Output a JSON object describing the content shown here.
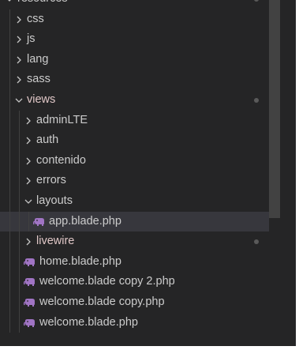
{
  "explorer": {
    "tree": [
      {
        "label": "resources",
        "twistie": "chevron-down-icon",
        "has_dot": true
      },
      {
        "label": "css",
        "twistie": "chevron-right-icon",
        "has_dot": false
      },
      {
        "label": "js",
        "twistie": "chevron-right-icon",
        "has_dot": false
      },
      {
        "label": "lang",
        "twistie": "chevron-right-icon",
        "has_dot": false
      },
      {
        "label": "sass",
        "twistie": "chevron-right-icon",
        "has_dot": false
      },
      {
        "label": "views",
        "twistie": "chevron-down-icon",
        "has_dot": true
      },
      {
        "label": "adminLTE",
        "twistie": "chevron-right-icon",
        "has_dot": false
      },
      {
        "label": "auth",
        "twistie": "chevron-right-icon",
        "has_dot": false
      },
      {
        "label": "contenido",
        "twistie": "chevron-right-icon",
        "has_dot": false
      },
      {
        "label": "errors",
        "twistie": "chevron-right-icon",
        "has_dot": false
      },
      {
        "label": "layouts",
        "twistie": "chevron-down-icon",
        "has_dot": false
      },
      {
        "label": "app.blade.php",
        "icon": "php-elephant-icon",
        "has_dot": false
      },
      {
        "label": "livewire",
        "twistie": "chevron-right-icon",
        "has_dot": true
      },
      {
        "label": "home.blade.php",
        "icon": "php-elephant-icon",
        "has_dot": false
      },
      {
        "label": "welcome.blade copy 2.php",
        "icon": "php-elephant-icon",
        "has_dot": false
      },
      {
        "label": "welcome.blade copy.php",
        "icon": "php-elephant-icon",
        "has_dot": false
      },
      {
        "label": "welcome.blade.php",
        "icon": "php-elephant-icon",
        "has_dot": false
      }
    ],
    "colors": {
      "background": "#252526",
      "text": "#cccccc",
      "php_icon": "#a074c4",
      "modified_dot": "#5a5a5a",
      "scrollbar_thumb": "#424242"
    }
  }
}
